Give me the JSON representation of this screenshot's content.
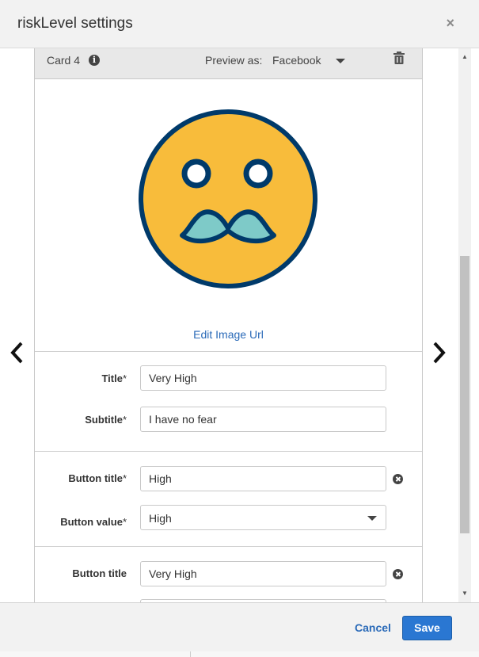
{
  "modal": {
    "title": "riskLevel settings",
    "close_glyph": "×"
  },
  "card": {
    "label": "Card 4",
    "info_glyph": "i",
    "preview_label": "Preview as:",
    "preview_value": "Facebook",
    "edit_image_link": "Edit Image Url",
    "image_icon": "mustache-face-emoji-icon",
    "emoji_colors": {
      "face": "#f8bc3b",
      "outline": "#003a6a",
      "eyes_fill": "#ffffff",
      "mustache": "#7ecac8"
    }
  },
  "fields": {
    "title_label": "Title",
    "title_value": "Very High",
    "subtitle_label": "Subtitle",
    "subtitle_value": "I have no fear",
    "button1_title_label": "Button title",
    "button1_title_value": "High",
    "button1_value_label": "Button value",
    "button1_value_selected": "High",
    "button2_title_label": "Button title",
    "button2_title_value": "Very High",
    "required_marker": "*"
  },
  "footer": {
    "cancel_label": "Cancel",
    "save_label": "Save"
  },
  "colors": {
    "accent": "#2a77d2",
    "link": "#2a6ab8",
    "header_bg": "#f2f2f2"
  },
  "icons": {
    "close": "close-icon",
    "info": "info-icon",
    "caret": "chevron-down-icon",
    "delete": "trash-icon",
    "remove": "remove-circle-icon",
    "prev": "chevron-left-icon",
    "next": "chevron-right-icon"
  }
}
